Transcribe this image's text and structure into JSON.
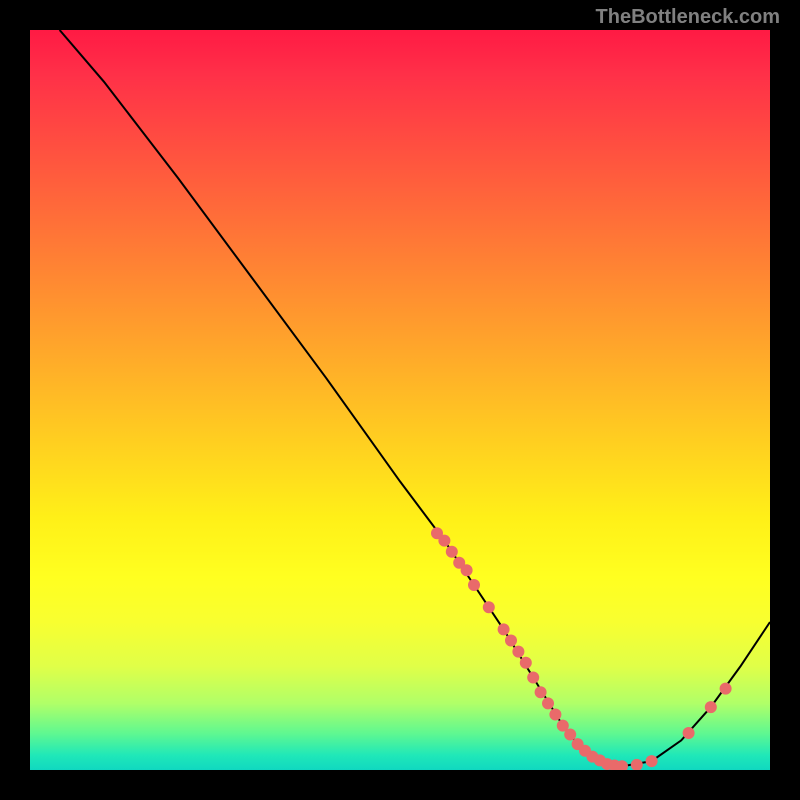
{
  "attribution": "TheBottleneck.com",
  "chart_data": {
    "type": "line",
    "title": "",
    "xlabel": "",
    "ylabel": "",
    "xlim": [
      0,
      100
    ],
    "ylim": [
      0,
      100
    ],
    "grid": false,
    "curve": {
      "x": [
        4,
        10,
        20,
        30,
        40,
        50,
        56,
        60,
        64,
        68,
        72,
        74,
        76,
        78,
        80,
        84,
        88,
        92,
        96,
        100
      ],
      "y": [
        100,
        93,
        80,
        66.5,
        53,
        39,
        31,
        25,
        19,
        12.5,
        6,
        3.5,
        1.8,
        0.8,
        0.5,
        1.2,
        4,
        8.5,
        14,
        20
      ]
    },
    "marker_series": {
      "name": "points",
      "color": "#e96a6a",
      "x": [
        55,
        56,
        57,
        58,
        59,
        60,
        62,
        64,
        65,
        66,
        67,
        68,
        69,
        70,
        71,
        72,
        73,
        74,
        75,
        76,
        77,
        78,
        79,
        80,
        82,
        84,
        89,
        92,
        94
      ],
      "y": [
        32,
        31,
        29.5,
        28,
        27,
        25,
        22,
        19,
        17.5,
        16,
        14.5,
        12.5,
        10.5,
        9,
        7.5,
        6,
        4.8,
        3.5,
        2.6,
        1.8,
        1.3,
        0.8,
        0.6,
        0.5,
        0.7,
        1.2,
        5,
        8.5,
        11
      ]
    }
  }
}
